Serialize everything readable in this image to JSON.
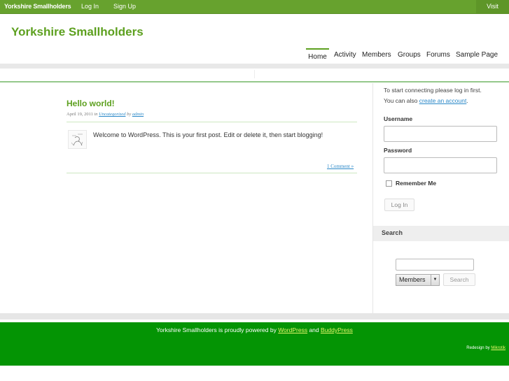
{
  "admin_bar": {
    "brand": "Yorkshire Smallholders",
    "login": "Log In",
    "signup": "Sign Up",
    "visit": "Visit"
  },
  "header": {
    "site_title": "Yorkshire Smallholders",
    "nav": [
      "Home",
      "Activity",
      "Members",
      "Groups",
      "Forums",
      "Sample Page"
    ],
    "current_nav": "Home"
  },
  "post": {
    "title": "Hello world!",
    "date": "April 19, 2011",
    "in_word": "in",
    "category": "Uncategorized",
    "by_word": "by",
    "author": "admin",
    "body": "Welcome to WordPress. This is your first post. Edit or delete it, then start blogging!",
    "comments": "1 Comment »"
  },
  "sidebar": {
    "intro": "To start connecting please log in first.",
    "also_prefix": "You can also ",
    "also_link": "create an account",
    "also_suffix": ".",
    "username_label": "Username",
    "username_value": "",
    "password_label": "Password",
    "password_value": "",
    "remember_label": "Remember Me",
    "remember_checked": false,
    "login_button": "Log In",
    "search_title": "Search",
    "search_value": "",
    "search_select": "Members",
    "search_button": "Search"
  },
  "footer": {
    "prefix": "Yorkshire Smallholders is proudly powered by ",
    "wordpress": "WordPress",
    "and": " and ",
    "buddypress": "BuddyPress",
    "credit_prefix": "Redesign by ",
    "credit_link": "Mikrotik"
  },
  "colors": {
    "brand_green": "#5da01f",
    "admin_bar": "#67a22e",
    "footer_green": "#049404",
    "link_blue": "#2a88c8"
  }
}
